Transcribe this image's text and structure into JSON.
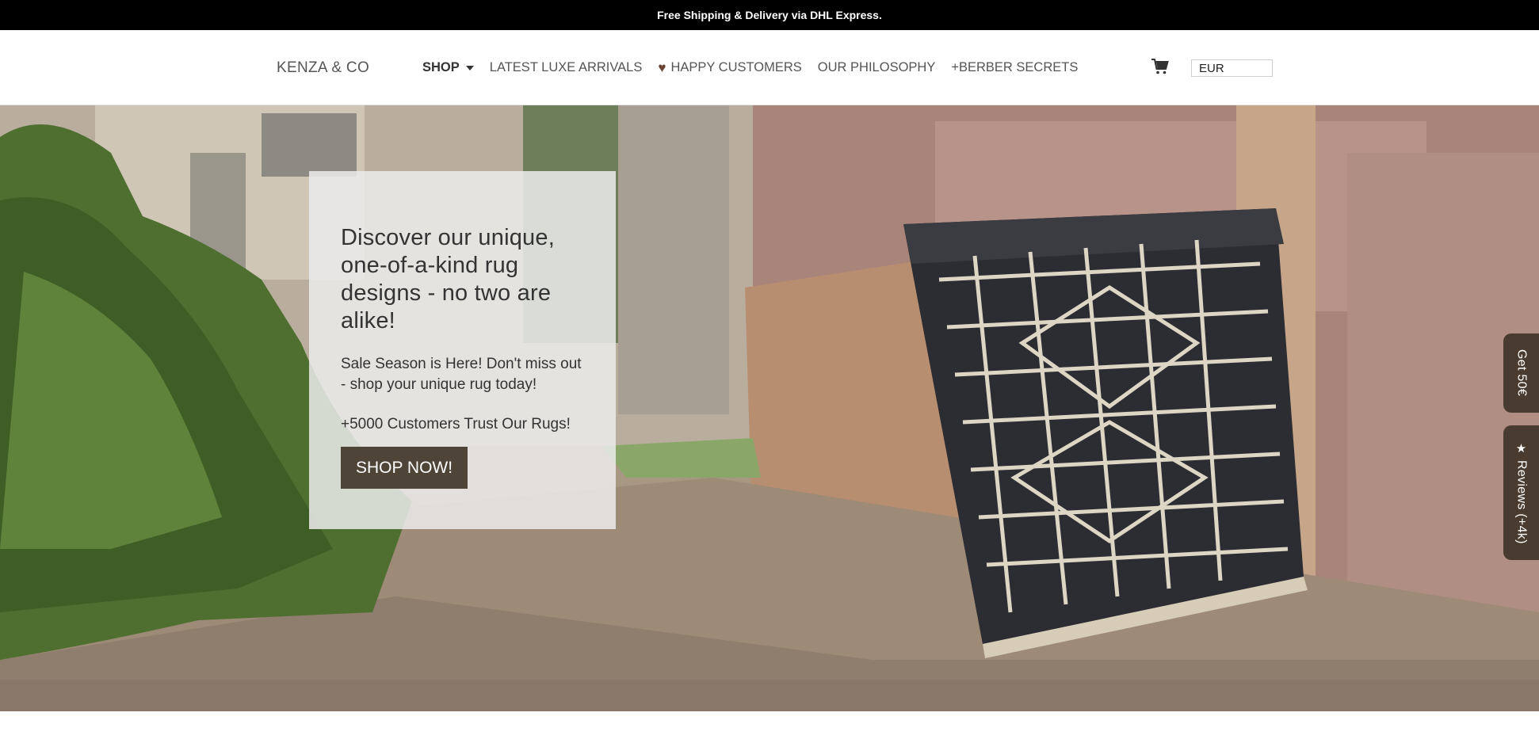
{
  "announcement": {
    "text": "Free Shipping & Delivery via DHL Express."
  },
  "header": {
    "logo": "KENZA & CO",
    "nav": [
      {
        "label": "SHOP",
        "has_dropdown": true
      },
      {
        "label": "LATEST LUXE ARRIVALS"
      },
      {
        "label": "HAPPY CUSTOMERS",
        "icon": "heart-icon"
      },
      {
        "label": "OUR PHILOSOPHY"
      },
      {
        "label": "+BERBER SECRETS"
      }
    ],
    "cart_icon": "cart-icon",
    "currency": "EUR"
  },
  "hero": {
    "title": "Discover our unique, one-of-a-kind rug designs - no two are alike!",
    "subtitle": "Sale Season is Here! Don't miss out - shop your unique rug today!",
    "trust": "+5000 Customers Trust Our Rugs!",
    "cta": "SHOP NOW!"
  },
  "side_tabs": {
    "get": "Get 50€",
    "reviews": "Reviews (+4k)"
  },
  "colors": {
    "announce_bg": "#000000",
    "button_bg": "#4f4438",
    "side_tab_bg": "#4a3b30",
    "heart": "#6b4332"
  }
}
